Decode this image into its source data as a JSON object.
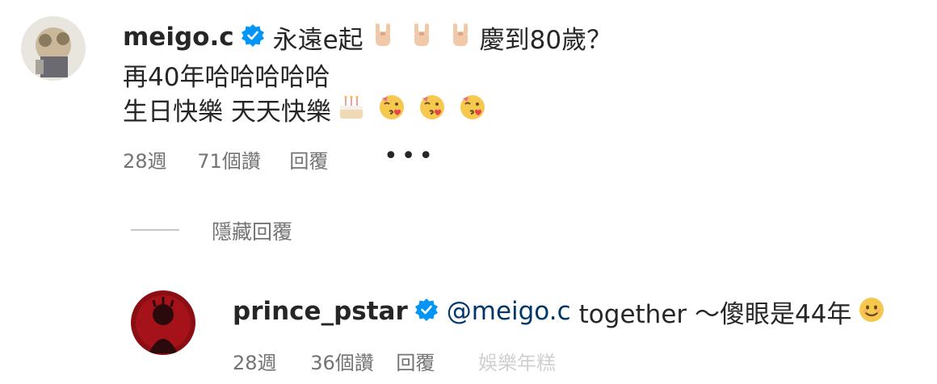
{
  "comment": {
    "username": "meigo.c",
    "text_part1": "永遠e起",
    "text_part2": "慶到80歲？",
    "line2": "再40年哈哈哈哈哈",
    "line3": "生日快樂 天天快樂",
    "time": "28週",
    "likes": "71個讚",
    "reply": "回覆",
    "more": "•••"
  },
  "hide_replies": "隱藏回覆",
  "reply_comment": {
    "username": "prince_pstar",
    "mention": "@meigo.c",
    "text": "together 〜傻眼是44年",
    "time": "28週",
    "likes": "36個讚",
    "reply": "回覆",
    "watermark": "娛樂年糕"
  },
  "colors": {
    "verified": "#0095f6",
    "mention": "#00376b",
    "meta": "#737373"
  },
  "icons": [
    "avatar",
    "verified-badge-icon",
    "rock-on-hand-emoji",
    "birthday-cake-emoji",
    "kissing-face-emoji",
    "smiling-face-emoji",
    "more-options-icon"
  ]
}
